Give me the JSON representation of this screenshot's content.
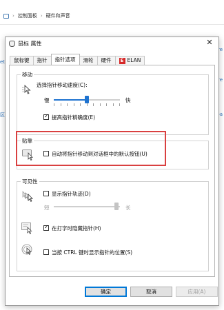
{
  "background": {
    "breadcrumb": [
      "控制面板",
      "硬件和声音"
    ],
    "left_fragments": [
      "et",
      "区域"
    ],
    "right_fragments": [
      "re",
      "re",
      "pa"
    ]
  },
  "dialog": {
    "title": "鼠标 属性",
    "close_glyph": "✕",
    "tabs": [
      {
        "label": "鼠标键",
        "active": false
      },
      {
        "label": "指针",
        "active": false
      },
      {
        "label": "指针选项",
        "active": true
      },
      {
        "label": "滑轮",
        "active": false
      },
      {
        "label": "硬件",
        "active": false
      },
      {
        "label": "ELAN",
        "active": false,
        "icon": "elan-icon",
        "icon_text": "E"
      }
    ],
    "motion": {
      "group_label": "移动",
      "speed_label": "选择指针移动速度(C):",
      "slow_label": "慢",
      "fast_label": "快",
      "speed_value": 0.5,
      "enhance_label": "提高指针精确度(E)",
      "enhance_checked": true
    },
    "snap": {
      "group_label": "贴靠",
      "auto_label": "自动将指针移动到对话框中的默认按钮(U)",
      "auto_checked": false
    },
    "visibility": {
      "group_label": "可见性",
      "trails_label": "显示指针轨迹(D)",
      "trails_checked": false,
      "short_label": "短",
      "long_label": "长",
      "trails_value": 0.95,
      "hide_label": "在打字时隐藏指针(H)",
      "hide_checked": true,
      "ctrl_label": "当按 CTRL 键时显示指针的位置(S)",
      "ctrl_checked": false
    },
    "buttons": {
      "ok": "确定",
      "cancel": "取消",
      "apply": "应用(A)"
    },
    "colors": {
      "accent": "#1e73d0",
      "highlight": "#d94040",
      "elan": "#d62828"
    }
  }
}
